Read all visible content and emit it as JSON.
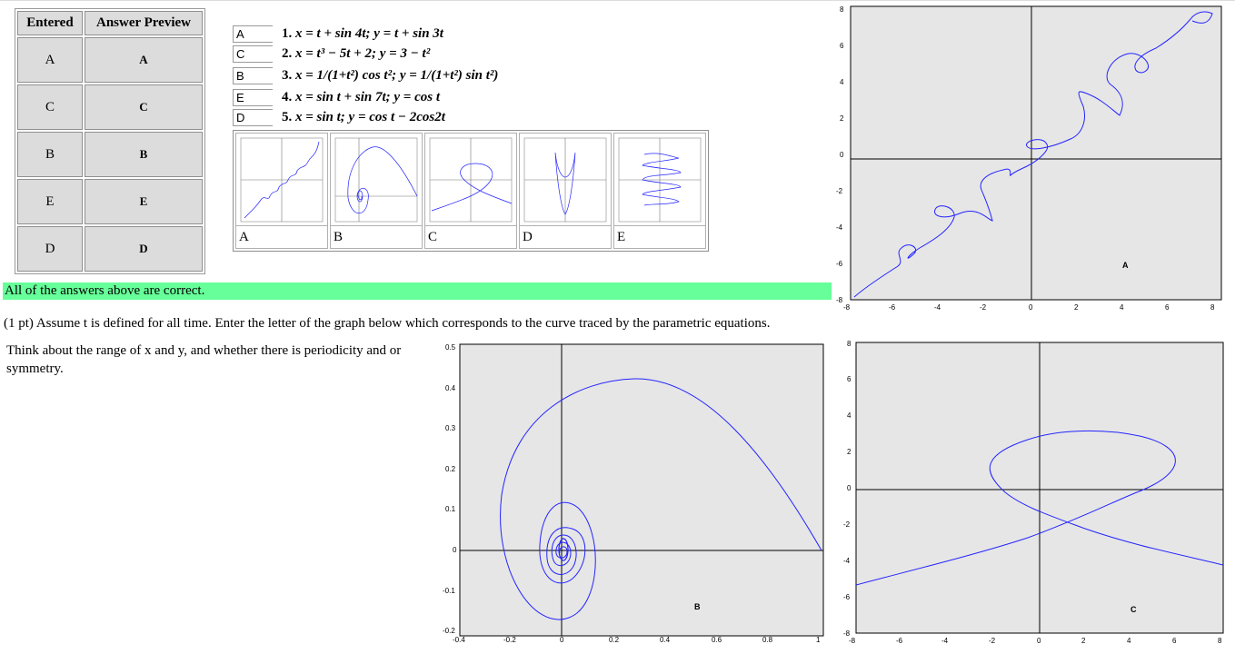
{
  "table": {
    "headers": [
      "Entered",
      "Answer Preview"
    ],
    "rows": [
      {
        "entered": "A",
        "preview": "A"
      },
      {
        "entered": "C",
        "preview": "C"
      },
      {
        "entered": "B",
        "preview": "B"
      },
      {
        "entered": "E",
        "preview": "E"
      },
      {
        "entered": "D",
        "preview": "D"
      }
    ]
  },
  "matching": {
    "rows": [
      {
        "answer": "A",
        "num": "1.",
        "eq": "x = t + sin 4t; y = t + sin 3t"
      },
      {
        "answer": "C",
        "num": "2.",
        "eq": "x = t³ − 5t + 2; y = 3 − t²"
      },
      {
        "answer": "B",
        "num": "3.",
        "eq": "x = 1/(1+t²) cos t²; y = 1/(1+t²) sin t²)"
      },
      {
        "answer": "E",
        "num": "4.",
        "eq": "x = sin t + sin 7t; y = cos t"
      },
      {
        "answer": "D",
        "num": "5.",
        "eq": "x = sin t; y = cos t − 2cos2t"
      }
    ],
    "graph_labels": [
      "A",
      "B",
      "C",
      "D",
      "E"
    ]
  },
  "status": {
    "correct_message": "All of the answers above are correct."
  },
  "question": {
    "text": "(1 pt) Assume t is defined for all time. Enter the letter of the graph below which corresponds to the curve traced by the parametric equations.",
    "hint": "Think about the range of x and y, and whether there is periodicity and or symmetry."
  },
  "plots": {
    "A": {
      "label": "A",
      "xlim": [
        -8,
        8
      ],
      "ylim": [
        -8,
        8
      ],
      "xticks": [
        "-8",
        "-6",
        "-4",
        "-2",
        "0",
        "2",
        "4",
        "6",
        "8"
      ],
      "yticks": [
        "8",
        "6",
        "4",
        "2",
        "0",
        "-2",
        "-4",
        "-6",
        "-8"
      ]
    },
    "B": {
      "label": "B",
      "xlim": [
        -0.4,
        1
      ],
      "ylim": [
        -0.2,
        0.5
      ],
      "xticks": [
        "-0.4",
        "-0.2",
        "0",
        "0.2",
        "0.4",
        "0.6",
        "0.8",
        "1"
      ],
      "yticks": [
        "0.5",
        "0.4",
        "0.3",
        "0.2",
        "0.1",
        "0",
        "-0.1",
        "-0.2"
      ]
    },
    "C": {
      "label": "C",
      "xlim": [
        -8,
        8
      ],
      "ylim": [
        -8,
        8
      ],
      "xticks": [
        "-8",
        "-6",
        "-4",
        "-2",
        "0",
        "2",
        "4",
        "6",
        "8"
      ],
      "yticks": [
        "8",
        "6",
        "4",
        "2",
        "0",
        "-2",
        "-4",
        "-6",
        "-8"
      ]
    }
  },
  "colors": {
    "curve": "#2424ff",
    "plot_bg": "#e6e6e6",
    "correct_bg": "#66ff99"
  }
}
